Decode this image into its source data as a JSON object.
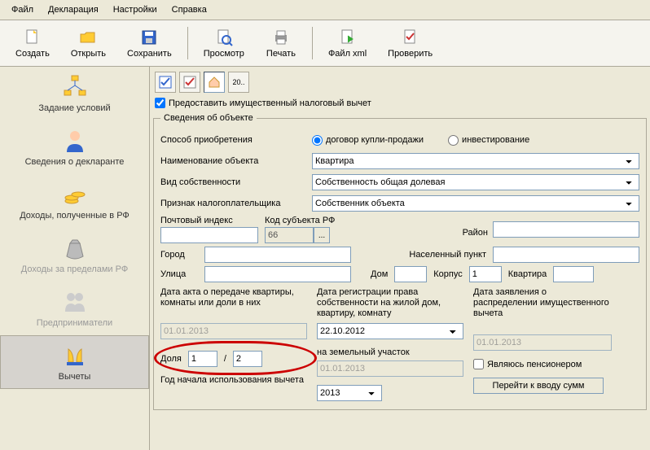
{
  "menu": {
    "file": "Файл",
    "declaration": "Декларация",
    "settings": "Настройки",
    "help": "Справка"
  },
  "toolbar": {
    "create": "Создать",
    "open": "Открыть",
    "save": "Сохранить",
    "preview": "Просмотр",
    "print": "Печать",
    "xml": "Файл xml",
    "check": "Проверить"
  },
  "sidebar": {
    "conditions": "Задание условий",
    "declarant": "Сведения о декларанте",
    "income_rf": "Доходы, полученные в РФ",
    "income_abroad": "Доходы за пределами РФ",
    "entrepreneurs": "Предприниматели",
    "deductions": "Вычеты"
  },
  "form": {
    "mini_20": "20..",
    "provide_deduction": "Предоставить имущественный налоговый вычет",
    "object_info": "Сведения об объекте",
    "acquisition_method": "Способ приобретения",
    "acq_contract": "договор купли-продажи",
    "acq_invest": "инвестирование",
    "object_name": "Наименование объекта",
    "object_name_val": "Квартира",
    "ownership_type": "Вид собственности",
    "ownership_val": "Собственность общая долевая",
    "taxpayer_sign": "Признак налогоплательщика",
    "taxpayer_val": "Собственник объекта",
    "postal": "Почтовый индекс",
    "postal_val": "",
    "subject_code": "Код субъекта РФ",
    "subject_val": "66",
    "district": "Район",
    "district_val": "",
    "city": "Город",
    "city_val": "",
    "locality": "Населенный пункт",
    "locality_val": "",
    "street": "Улица",
    "street_val": "",
    "house": "Дом",
    "house_val": "",
    "building": "Корпус",
    "building_val": "1",
    "apt": "Квартира",
    "apt_val": "",
    "date_act": "Дата акта о передаче квартиры, комнаты или доли в них",
    "date_act_val": "01.01.2013",
    "date_reg": "Дата регистрации права собственности на жилой дом, квартиру, комнату",
    "date_reg_val": "22.10.2012",
    "date_land": "на земельный участок",
    "date_land_val": "01.01.2013",
    "date_appl": "Дата заявления о распределении имущественного вычета",
    "date_appl_val": "01.01.2013",
    "share": "Доля",
    "share_num": "1",
    "share_den": "2",
    "share_sep": "/",
    "pensioner": "Являюсь пенсионером",
    "year_start": "Год начала использования вычета",
    "year_start_val": "2013",
    "goto_sums": "Перейти к вводу сумм"
  }
}
